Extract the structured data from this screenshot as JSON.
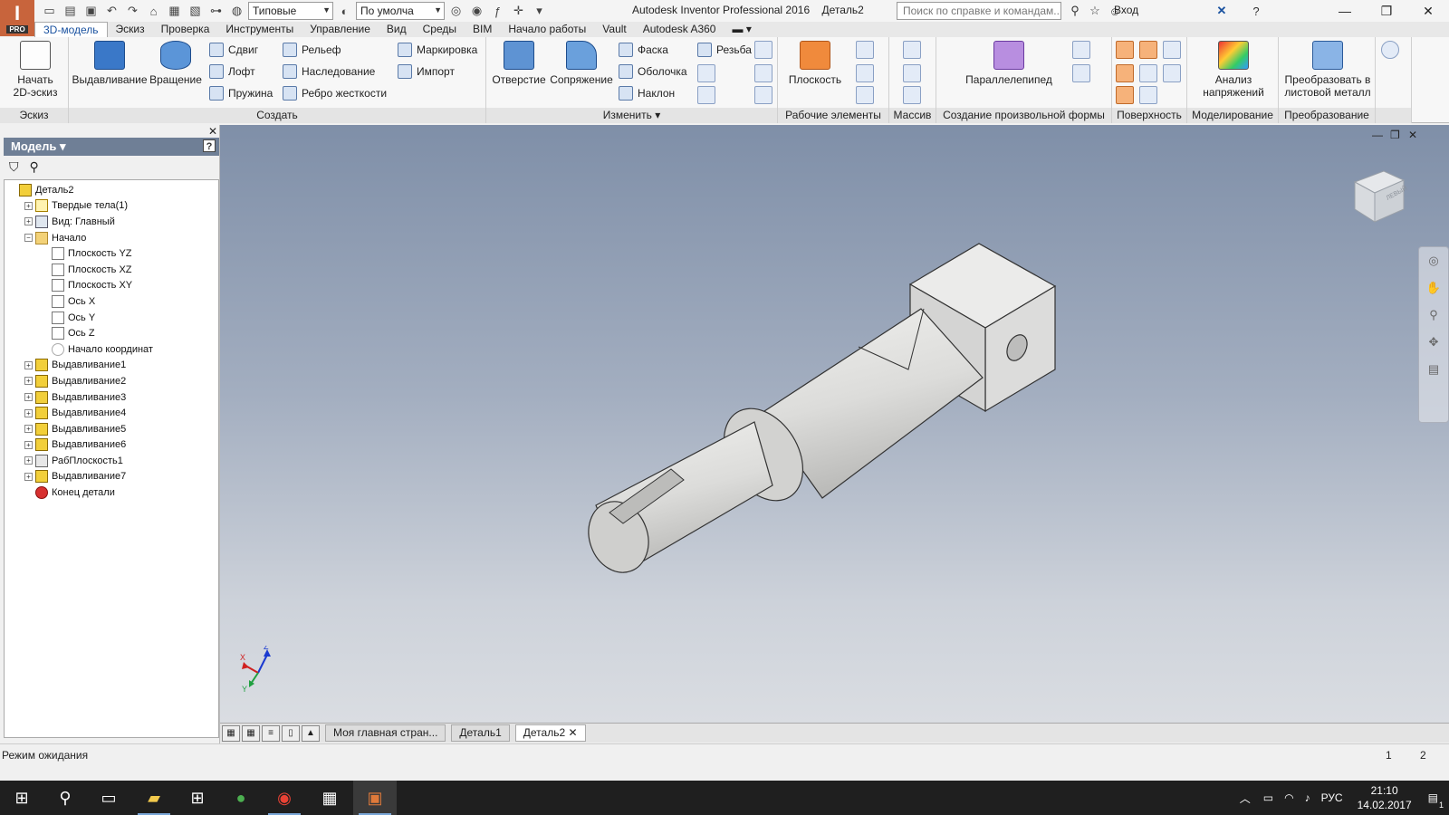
{
  "titlebar": {
    "style_combo": "Типовые",
    "appearance_combo": "По умолча",
    "app_title": "Autodesk Inventor Professional 2016",
    "doc_title": "Деталь2",
    "search_placeholder": "Поиск по справке и командам...",
    "signin": "Вход",
    "logo_letter": "I",
    "logo_badge": "PRO"
  },
  "ribbon_tabs": [
    "3D-модель",
    "Эскиз",
    "Проверка",
    "Инструменты",
    "Управление",
    "Вид",
    "Среды",
    "BIM",
    "Начало работы",
    "Vault",
    "Autodesk A360"
  ],
  "ribbon": {
    "sketch_panel": {
      "label": "Эскиз",
      "start_sketch": "Начать 2D-эскиз"
    },
    "create_panel": {
      "label": "Создать",
      "extrude": "Выдавливание",
      "revolve": "Вращение",
      "sweep": "Сдвиг",
      "loft": "Лофт",
      "coil": "Пружина",
      "emboss": "Рельеф",
      "derive": "Наследование",
      "rib": "Ребро жесткости",
      "decal": "Маркировка",
      "import": "Импорт"
    },
    "modify_panel": {
      "label": "Изменить",
      "hole": "Отверстие",
      "fillet": "Сопряжение",
      "chamfer": "Фаска",
      "shell": "Оболочка",
      "draft": "Наклон",
      "thread": "Резьба"
    },
    "work_panel": {
      "label": "Рабочие элементы",
      "plane": "Плоскость"
    },
    "pattern_panel": {
      "label": "Массив"
    },
    "freeform_panel": {
      "label": "Создание произвольной формы",
      "box": "Параллелепипед"
    },
    "surface_panel": {
      "label": "Поверхность"
    },
    "simulation_panel": {
      "label": "Моделирование",
      "stress": "Анализ напряжений"
    },
    "convert_panel": {
      "label": "Преобразование",
      "sheetmetal": "Преобразовать в листовой металл"
    }
  },
  "browser": {
    "title": "Модель",
    "help": "?",
    "tree": [
      {
        "label": "Деталь2",
        "level": 0,
        "expander": "",
        "icon": "part"
      },
      {
        "label": "Твердые тела(1)",
        "level": 1,
        "expander": "+",
        "icon": "solid"
      },
      {
        "label": "Вид: Главный",
        "level": 1,
        "expander": "+",
        "icon": "view"
      },
      {
        "label": "Начало",
        "level": 1,
        "expander": "−",
        "icon": "folder"
      },
      {
        "label": "Плоскость YZ",
        "level": 2,
        "expander": "",
        "icon": "plane"
      },
      {
        "label": "Плоскость XZ",
        "level": 2,
        "expander": "",
        "icon": "plane"
      },
      {
        "label": "Плоскость XY",
        "level": 2,
        "expander": "",
        "icon": "plane"
      },
      {
        "label": "Ось X",
        "level": 2,
        "expander": "",
        "icon": "axis"
      },
      {
        "label": "Ось Y",
        "level": 2,
        "expander": "",
        "icon": "axis"
      },
      {
        "label": "Ось Z",
        "level": 2,
        "expander": "",
        "icon": "axis"
      },
      {
        "label": "Начало координат",
        "level": 2,
        "expander": "",
        "icon": "origin"
      },
      {
        "label": "Выдавливание1",
        "level": 1,
        "expander": "+",
        "icon": "extrude"
      },
      {
        "label": "Выдавливание2",
        "level": 1,
        "expander": "+",
        "icon": "extrude"
      },
      {
        "label": "Выдавливание3",
        "level": 1,
        "expander": "+",
        "icon": "extrude"
      },
      {
        "label": "Выдавливание4",
        "level": 1,
        "expander": "+",
        "icon": "extrude"
      },
      {
        "label": "Выдавливание5",
        "level": 1,
        "expander": "+",
        "icon": "extrude"
      },
      {
        "label": "Выдавливание6",
        "level": 1,
        "expander": "+",
        "icon": "extrude"
      },
      {
        "label": "РабПлоскость1",
        "level": 1,
        "expander": "+",
        "icon": "workplane"
      },
      {
        "label": "Выдавливание7",
        "level": 1,
        "expander": "+",
        "icon": "extrude"
      },
      {
        "label": "Конец детали",
        "level": 1,
        "expander": "",
        "icon": "end"
      }
    ]
  },
  "viewport": {
    "viewcube_label": "ЛЕВЫЙ",
    "triad": {
      "x": "X",
      "y": "Y",
      "z": "Z"
    }
  },
  "doc_tabs": [
    "Моя главная стран...",
    "Деталь1",
    "Деталь2"
  ],
  "active_doc_tab": "Деталь2",
  "status": {
    "text": "Режим ожидания",
    "n1": "1",
    "n2": "2"
  },
  "taskbar": {
    "lang": "РУС",
    "time": "21:10",
    "date": "14.02.2017",
    "notifications": "1"
  },
  "colors": {
    "accent": "#1a52a0",
    "logo": "#c8643c",
    "part": "#e2e2e0"
  }
}
